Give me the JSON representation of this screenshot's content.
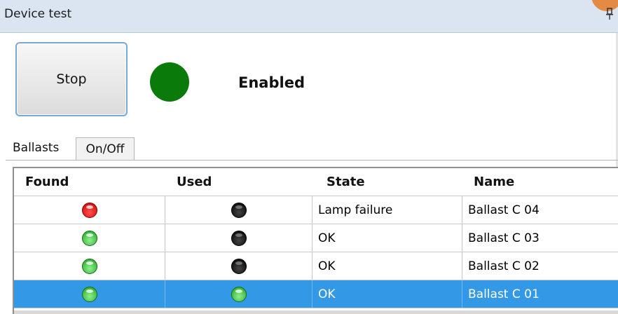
{
  "window": {
    "title": "Device test"
  },
  "controls": {
    "stop_label": "Stop",
    "status_text": "Enabled",
    "status_color": "#0a7a0a"
  },
  "tabs": [
    {
      "label": "Ballasts",
      "active": true
    },
    {
      "label": "On/Off",
      "active": false
    }
  ],
  "table": {
    "columns": [
      "Found",
      "Used",
      "State",
      "Name"
    ],
    "rows": [
      {
        "found": "red",
        "used": "black",
        "state": "Lamp failure",
        "name": "Ballast C 04",
        "selected": false
      },
      {
        "found": "green",
        "used": "black",
        "state": "OK",
        "name": "Ballast C 03",
        "selected": false
      },
      {
        "found": "green",
        "used": "black",
        "state": "OK",
        "name": "Ballast C 02",
        "selected": false
      },
      {
        "found": "green",
        "used": "green",
        "state": "OK",
        "name": "Ballast C 01",
        "selected": true
      }
    ]
  },
  "icons": {
    "pin": "pin-icon",
    "led": "indicator-led-icon"
  },
  "colors": {
    "selection": "#3399e6",
    "titlebar": "#dbe5f1",
    "accent": "#e38a45"
  }
}
